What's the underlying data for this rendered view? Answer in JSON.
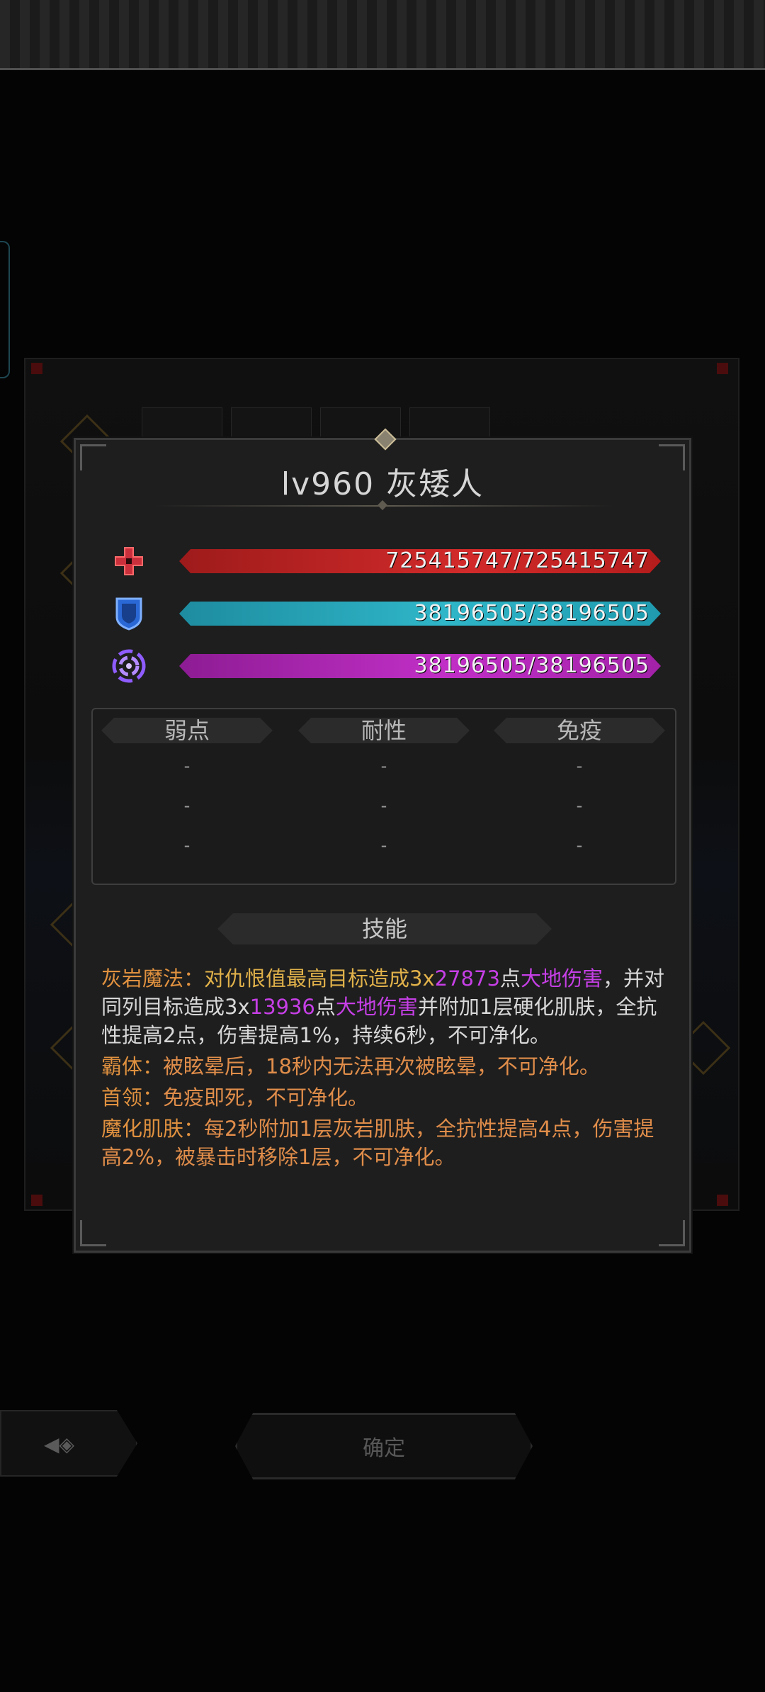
{
  "monster": {
    "title": "lv960 灰矮人",
    "hp": {
      "icon": "red-cross-icon",
      "value_text": "725415747/725415747",
      "fraction": 1.0,
      "color": "#d22a2a"
    },
    "shield": {
      "icon": "shield-icon",
      "value_text": "38196505/38196505",
      "fraction": 1.0,
      "color": "#2fb6c8"
    },
    "mana": {
      "icon": "swirl-icon",
      "value_text": "38196505/38196505",
      "fraction": 1.0,
      "color": "#c12fc6"
    }
  },
  "resistances": {
    "headers": [
      "弱点",
      "耐性",
      "免疫"
    ],
    "rows": [
      [
        "-",
        "-",
        "-"
      ],
      [
        "-",
        "-",
        "-"
      ],
      [
        "-",
        "-",
        "-"
      ]
    ]
  },
  "skills_header": "技能",
  "skills": [
    {
      "name": "灰岩魔法",
      "sep": "：",
      "parts": [
        {
          "text": "对仇恨值最高目标造成3x",
          "color": "text"
        },
        {
          "text": "27873",
          "color": "purple"
        },
        {
          "text": "点",
          "color": "white"
        },
        {
          "text": "大地伤害",
          "color": "purple"
        },
        {
          "text": "，并对同列目标造成3x",
          "color": "white"
        },
        {
          "text": "13936",
          "color": "purple"
        },
        {
          "text": "点",
          "color": "white"
        },
        {
          "text": "大地伤害",
          "color": "purple"
        },
        {
          "text": "并附加1层硬化肌肤，全抗性提高2点，伤害提高1%，持续6秒，不可净化。",
          "color": "white"
        }
      ]
    },
    {
      "name": "霸体",
      "sep": "：",
      "parts": [
        {
          "text": "被眩晕后，18秒内无法再次被眩晕，不可净化。",
          "color": "orange"
        }
      ]
    },
    {
      "name": "首领",
      "sep": "：",
      "parts": [
        {
          "text": "免疫即死，不可净化。",
          "color": "orange"
        }
      ]
    },
    {
      "name": "魔化肌肤",
      "sep": "：",
      "parts": [
        {
          "text": "每2秒附加1层灰岩肌肤，全抗性提高4点，伤害提高2%，被暴击时移除1层，不可净化。",
          "color": "orange"
        }
      ]
    }
  ],
  "buttons": {
    "confirm_label": "确定",
    "back_icon": "back-arrow-icon"
  }
}
